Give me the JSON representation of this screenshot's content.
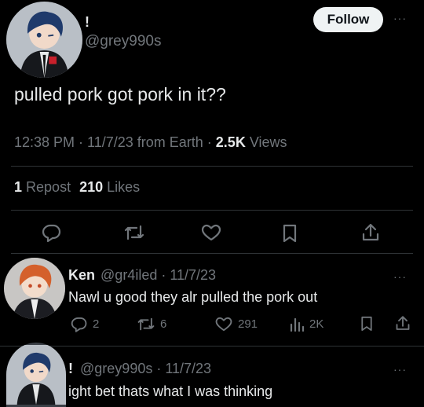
{
  "main_tweet": {
    "display_name": "!",
    "handle": "@grey990s",
    "follow_label": "Follow",
    "more_label": "···",
    "text": "pulled pork got pork in it??",
    "meta_time": "12:38 PM · 11/7/23 from Earth ·",
    "views_count": "2.5K",
    "views_label": "Views",
    "repost_count": "1",
    "repost_label": "Repost",
    "like_count": "210",
    "like_label": "Likes",
    "icons": [
      "reply-icon",
      "retweet-icon",
      "like-icon",
      "bookmark-icon",
      "share-icon"
    ]
  },
  "replies": [
    {
      "display_name": "Ken",
      "handle_date": "@gr4iled · 11/7/23",
      "more_label": "···",
      "text": "Nawl u good they alr pulled the pork out",
      "reply_count": "2",
      "retweet_count": "6",
      "like_count": "291",
      "view_count": "2K"
    },
    {
      "display_name": "!",
      "handle_date": "@grey990s · 11/7/23",
      "more_label": "···",
      "text": "ight bet thats what I was thinking"
    }
  ],
  "colors": {
    "background": "#000000",
    "text": "#e7e9ea",
    "muted": "#71767b",
    "divider": "#2f3336",
    "follow_bg": "#eff3f4"
  }
}
